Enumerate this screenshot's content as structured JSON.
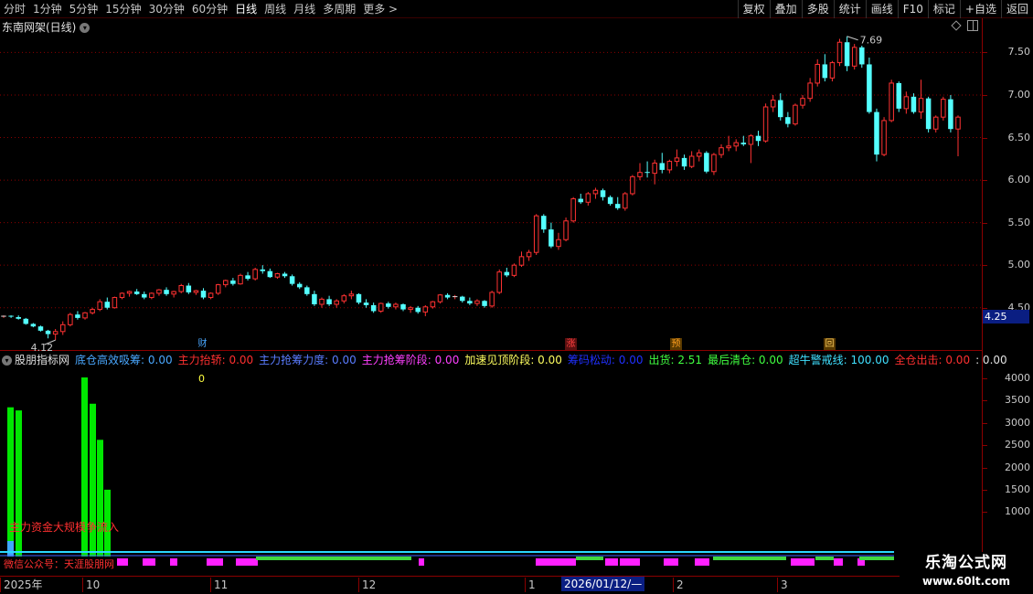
{
  "toolbar": {
    "periods": [
      "分时",
      "1分钟",
      "5分钟",
      "15分钟",
      "30分钟",
      "60分钟",
      "日线",
      "周线",
      "月线",
      "多周期",
      "更多 >"
    ],
    "active_period": "日线",
    "tools": [
      "复权",
      "叠加",
      "多股",
      "统计",
      "画线",
      "F10",
      "标记",
      "+自选",
      "返回"
    ]
  },
  "chart": {
    "title": "东南网架(日线)",
    "price_ticks": [
      "7.50",
      "7.00",
      "6.50",
      "6.00",
      "5.50",
      "5.00",
      "4.50"
    ],
    "current_price": "4.25",
    "high_label": "7.69",
    "low_label": "4.12",
    "markers": [
      {
        "text": "财",
        "color": "#4aa8ff",
        "bg": "#000"
      },
      {
        "text": "涨",
        "color": "#ff4040",
        "bg": "#5a1010"
      },
      {
        "text": "预",
        "color": "#ffa020",
        "bg": "#5a3a00"
      },
      {
        "text": "回",
        "color": "#ffd060",
        "bg": "#5a3a00"
      }
    ]
  },
  "indicator": {
    "name": "股朋指标网",
    "items": [
      {
        "label": "底仓高效吸筹: 0.00",
        "color": "#4aa8ff"
      },
      {
        "label": "主力抬轿: 0.00",
        "color": "#ff3030"
      },
      {
        "label": "主力抢筹力度: 0.00",
        "color": "#5a7cff"
      },
      {
        "label": "主力抢筹阶段: 0.00",
        "color": "#ff40ff"
      },
      {
        "label": "加速见顶阶段: 0.00",
        "color": "#ffff60"
      },
      {
        "label": "筹码松动: 0.00",
        "color": "#2030ff"
      },
      {
        "label": "出货: 2.51",
        "color": "#40ff40"
      },
      {
        "label": "最后清仓: 0.00",
        "color": "#40ff40"
      },
      {
        "label": "超牛警戒线: 100.00",
        "color": "#40e0ff"
      },
      {
        "label": "全仓出击: 0.00",
        "color": "#ff3030"
      },
      {
        "label": ": 0.00",
        "color": "#e0e0e0"
      }
    ],
    "zero_label": "0",
    "flow_note": "主力资金大规模争流入",
    "wechat_note": "微信公众号：天涯股朋网",
    "vol_ticks": [
      "4000",
      "3500",
      "3000",
      "2500",
      "2000",
      "1500",
      "1000"
    ],
    "bar_values": [
      3350,
      3280,
      4020,
      3430,
      2620,
      1500
    ]
  },
  "dates": {
    "labels": [
      "2025年",
      "10",
      "11",
      "12",
      "1",
      "2",
      "3"
    ],
    "cursor": "2026/01/12/—"
  },
  "watermark": {
    "title": "乐淘公式网",
    "url": "www.60lt.com"
  },
  "colors": {
    "up": "#ff3232",
    "down": "#54ffff",
    "grid": "#8b0000",
    "cursor_bg": "#0a1e82"
  },
  "chart_data": {
    "type": "candlestick",
    "ohlc": [
      [
        4.39,
        4.41,
        4.38,
        4.4
      ],
      [
        4.4,
        4.41,
        4.38,
        4.39
      ],
      [
        4.39,
        4.41,
        4.36,
        4.37
      ],
      [
        4.37,
        4.38,
        4.3,
        4.31
      ],
      [
        4.31,
        4.32,
        4.27,
        4.28
      ],
      [
        4.28,
        4.29,
        4.22,
        4.23
      ],
      [
        4.23,
        4.24,
        4.14,
        4.19
      ],
      [
        4.19,
        4.25,
        4.12,
        4.22
      ],
      [
        4.22,
        4.34,
        4.18,
        4.3
      ],
      [
        4.3,
        4.44,
        4.28,
        4.42
      ],
      [
        4.42,
        4.46,
        4.36,
        4.38
      ],
      [
        4.38,
        4.45,
        4.36,
        4.44
      ],
      [
        4.44,
        4.5,
        4.42,
        4.48
      ],
      [
        4.48,
        4.6,
        4.46,
        4.57
      ],
      [
        4.57,
        4.62,
        4.48,
        4.5
      ],
      [
        4.5,
        4.63,
        4.49,
        4.62
      ],
      [
        4.62,
        4.68,
        4.6,
        4.67
      ],
      [
        4.67,
        4.7,
        4.63,
        4.69
      ],
      [
        4.69,
        4.72,
        4.65,
        4.66
      ],
      [
        4.66,
        4.69,
        4.6,
        4.62
      ],
      [
        4.62,
        4.68,
        4.6,
        4.67
      ],
      [
        4.67,
        4.72,
        4.64,
        4.71
      ],
      [
        4.71,
        4.74,
        4.64,
        4.66
      ],
      [
        4.66,
        4.7,
        4.62,
        4.69
      ],
      [
        4.69,
        4.78,
        4.67,
        4.76
      ],
      [
        4.76,
        4.79,
        4.66,
        4.68
      ],
      [
        4.68,
        4.71,
        4.65,
        4.7
      ],
      [
        4.7,
        4.73,
        4.6,
        4.62
      ],
      [
        4.62,
        4.68,
        4.6,
        4.67
      ],
      [
        4.67,
        4.78,
        4.65,
        4.77
      ],
      [
        4.77,
        4.83,
        4.74,
        4.82
      ],
      [
        4.82,
        4.85,
        4.76,
        4.78
      ],
      [
        4.78,
        4.9,
        4.77,
        4.88
      ],
      [
        4.88,
        4.92,
        4.82,
        4.84
      ],
      [
        4.84,
        4.97,
        4.82,
        4.95
      ],
      [
        4.95,
        5.0,
        4.9,
        4.93
      ],
      [
        4.93,
        4.96,
        4.85,
        4.86
      ],
      [
        4.86,
        4.91,
        4.84,
        4.9
      ],
      [
        4.9,
        4.92,
        4.85,
        4.87
      ],
      [
        4.87,
        4.89,
        4.76,
        4.78
      ],
      [
        4.78,
        4.8,
        4.72,
        4.74
      ],
      [
        4.74,
        4.76,
        4.64,
        4.66
      ],
      [
        4.66,
        4.7,
        4.52,
        4.54
      ],
      [
        4.54,
        4.62,
        4.5,
        4.6
      ],
      [
        4.6,
        4.64,
        4.52,
        4.54
      ],
      [
        4.54,
        4.6,
        4.5,
        4.58
      ],
      [
        4.58,
        4.66,
        4.55,
        4.64
      ],
      [
        4.64,
        4.7,
        4.6,
        4.66
      ],
      [
        4.66,
        4.67,
        4.54,
        4.56
      ],
      [
        4.56,
        4.6,
        4.5,
        4.53
      ],
      [
        4.53,
        4.56,
        4.44,
        4.46
      ],
      [
        4.46,
        4.56,
        4.44,
        4.55
      ],
      [
        4.55,
        4.57,
        4.49,
        4.51
      ],
      [
        4.51,
        4.56,
        4.48,
        4.54
      ],
      [
        4.54,
        4.55,
        4.46,
        4.48
      ],
      [
        4.48,
        4.52,
        4.44,
        4.5
      ],
      [
        4.5,
        4.52,
        4.43,
        4.45
      ],
      [
        4.45,
        4.53,
        4.4,
        4.51
      ],
      [
        4.51,
        4.58,
        4.49,
        4.57
      ],
      [
        4.57,
        4.66,
        4.55,
        4.65
      ],
      [
        4.65,
        4.67,
        4.6,
        4.62
      ],
      [
        4.62,
        4.65,
        4.6,
        4.63
      ],
      [
        4.63,
        4.64,
        4.56,
        4.58
      ],
      [
        4.58,
        4.62,
        4.53,
        4.55
      ],
      [
        4.55,
        4.6,
        4.52,
        4.58
      ],
      [
        4.58,
        4.59,
        4.5,
        4.52
      ],
      [
        4.52,
        4.7,
        4.5,
        4.68
      ],
      [
        4.68,
        4.95,
        4.66,
        4.92
      ],
      [
        4.92,
        4.97,
        4.86,
        4.88
      ],
      [
        4.88,
        5.02,
        4.86,
        5.0
      ],
      [
        5.0,
        5.16,
        4.98,
        5.1
      ],
      [
        5.1,
        5.18,
        5.05,
        5.15
      ],
      [
        5.15,
        5.6,
        5.12,
        5.58
      ],
      [
        5.58,
        5.6,
        5.38,
        5.42
      ],
      [
        5.42,
        5.5,
        5.2,
        5.22
      ],
      [
        5.22,
        5.38,
        5.18,
        5.3
      ],
      [
        5.3,
        5.56,
        5.28,
        5.52
      ],
      [
        5.52,
        5.8,
        5.5,
        5.78
      ],
      [
        5.78,
        5.84,
        5.72,
        5.74
      ],
      [
        5.74,
        5.86,
        5.7,
        5.84
      ],
      [
        5.84,
        5.91,
        5.78,
        5.88
      ],
      [
        5.88,
        5.9,
        5.76,
        5.8
      ],
      [
        5.8,
        5.82,
        5.7,
        5.72
      ],
      [
        5.72,
        5.8,
        5.65,
        5.67
      ],
      [
        5.67,
        5.86,
        5.64,
        5.84
      ],
      [
        5.84,
        6.06,
        5.82,
        6.04
      ],
      [
        6.04,
        6.2,
        6.0,
        6.09
      ],
      [
        6.09,
        6.22,
        6.03,
        6.08
      ],
      [
        6.08,
        6.24,
        5.95,
        6.2
      ],
      [
        6.2,
        6.32,
        6.08,
        6.12
      ],
      [
        6.12,
        6.24,
        6.08,
        6.22
      ],
      [
        6.22,
        6.36,
        6.16,
        6.26
      ],
      [
        6.26,
        6.3,
        6.12,
        6.16
      ],
      [
        6.16,
        6.34,
        6.14,
        6.28
      ],
      [
        6.28,
        6.36,
        6.22,
        6.32
      ],
      [
        6.32,
        6.34,
        6.08,
        6.1
      ],
      [
        6.1,
        6.32,
        6.06,
        6.3
      ],
      [
        6.3,
        6.42,
        6.26,
        6.38
      ],
      [
        6.38,
        6.52,
        6.34,
        6.4
      ],
      [
        6.4,
        6.48,
        6.34,
        6.44
      ],
      [
        6.44,
        6.52,
        6.4,
        6.42
      ],
      [
        6.42,
        6.54,
        6.2,
        6.52
      ],
      [
        6.52,
        6.58,
        6.4,
        6.46
      ],
      [
        6.46,
        6.9,
        6.44,
        6.86
      ],
      [
        6.86,
        7.0,
        6.8,
        6.94
      ],
      [
        6.94,
        7.02,
        6.7,
        6.74
      ],
      [
        6.74,
        6.8,
        6.62,
        6.66
      ],
      [
        6.66,
        6.9,
        6.64,
        6.88
      ],
      [
        6.88,
        7.0,
        6.84,
        6.96
      ],
      [
        6.96,
        7.2,
        6.92,
        7.14
      ],
      [
        7.14,
        7.42,
        7.1,
        7.36
      ],
      [
        7.36,
        7.48,
        7.16,
        7.2
      ],
      [
        7.2,
        7.4,
        7.16,
        7.38
      ],
      [
        7.38,
        7.66,
        7.34,
        7.62
      ],
      [
        7.62,
        7.69,
        7.28,
        7.34
      ],
      [
        7.34,
        7.6,
        7.3,
        7.56
      ],
      [
        7.56,
        7.58,
        7.32,
        7.36
      ],
      [
        7.36,
        7.44,
        6.78,
        6.8
      ],
      [
        6.8,
        6.84,
        6.22,
        6.3
      ],
      [
        6.3,
        6.74,
        6.28,
        6.7
      ],
      [
        6.7,
        7.18,
        6.68,
        7.14
      ],
      [
        7.14,
        7.16,
        6.8,
        6.84
      ],
      [
        6.84,
        7.04,
        6.78,
        6.98
      ],
      [
        6.98,
        7.02,
        6.78,
        6.8
      ],
      [
        6.8,
        7.18,
        6.72,
        6.96
      ],
      [
        6.96,
        6.98,
        6.56,
        6.6
      ],
      [
        6.6,
        6.76,
        6.56,
        6.74
      ],
      [
        6.74,
        6.98,
        6.7,
        6.95
      ],
      [
        6.95,
        7.0,
        6.56,
        6.6
      ],
      [
        6.6,
        6.76,
        6.28,
        6.74
      ]
    ]
  }
}
